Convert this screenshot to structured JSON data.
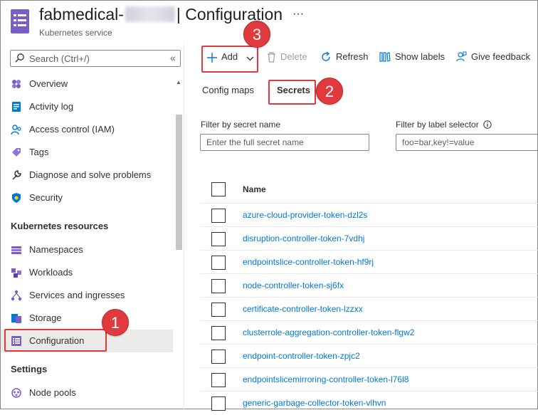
{
  "header": {
    "title_prefix": "fabmedical-",
    "title_suffix": "| Configuration",
    "more": "···",
    "subtitle": "Kubernetes service"
  },
  "sidebar": {
    "search_placeholder": "Search (Ctrl+/)",
    "collapse": "«",
    "items_top": [
      {
        "label": "Overview",
        "icon": "overview-icon"
      },
      {
        "label": "Activity log",
        "icon": "activity-log-icon"
      },
      {
        "label": "Access control (IAM)",
        "icon": "iam-icon"
      },
      {
        "label": "Tags",
        "icon": "tag-icon"
      },
      {
        "label": "Diagnose and solve problems",
        "icon": "wrench-icon"
      },
      {
        "label": "Security",
        "icon": "shield-icon"
      }
    ],
    "section_k8s": "Kubernetes resources",
    "items_k8s": [
      {
        "label": "Namespaces",
        "icon": "namespaces-icon"
      },
      {
        "label": "Workloads",
        "icon": "workloads-icon"
      },
      {
        "label": "Services and ingresses",
        "icon": "services-icon"
      },
      {
        "label": "Storage",
        "icon": "storage-icon"
      },
      {
        "label": "Configuration",
        "icon": "configuration-icon",
        "active": true
      }
    ],
    "section_settings": "Settings",
    "items_settings": [
      {
        "label": "Node pools",
        "icon": "node-pools-icon"
      }
    ]
  },
  "toolbar": {
    "add": "Add",
    "delete": "Delete",
    "refresh": "Refresh",
    "show_labels": "Show labels",
    "give_feedback": "Give feedback"
  },
  "tabs": {
    "config_maps": "Config maps",
    "secrets": "Secrets",
    "selected": "Secrets"
  },
  "filters": {
    "secret_name_label": "Filter by secret name",
    "secret_name_placeholder": "Enter the full secret name",
    "label_selector_label": "Filter by label selector",
    "label_selector_placeholder": "foo=bar,key!=value"
  },
  "table": {
    "column_name": "Name",
    "rows": [
      "azure-cloud-provider-token-dzl2s",
      "disruption-controller-token-7vdhj",
      "endpointslice-controller-token-hf9rj",
      "node-controller-token-sj6fx",
      "certificate-controller-token-lzzxx",
      "clusterrole-aggregation-controller-token-flgw2",
      "endpoint-controller-token-zpjc2",
      "endpointslicemirroring-controller-token-l76l8",
      "generic-garbage-collector-token-vlhvn"
    ]
  },
  "callouts": {
    "one": "1",
    "two": "2",
    "three": "3"
  },
  "colors": {
    "accent": "#0078d4",
    "callout": "#e03a3e",
    "active_bg": "#edebe9"
  }
}
